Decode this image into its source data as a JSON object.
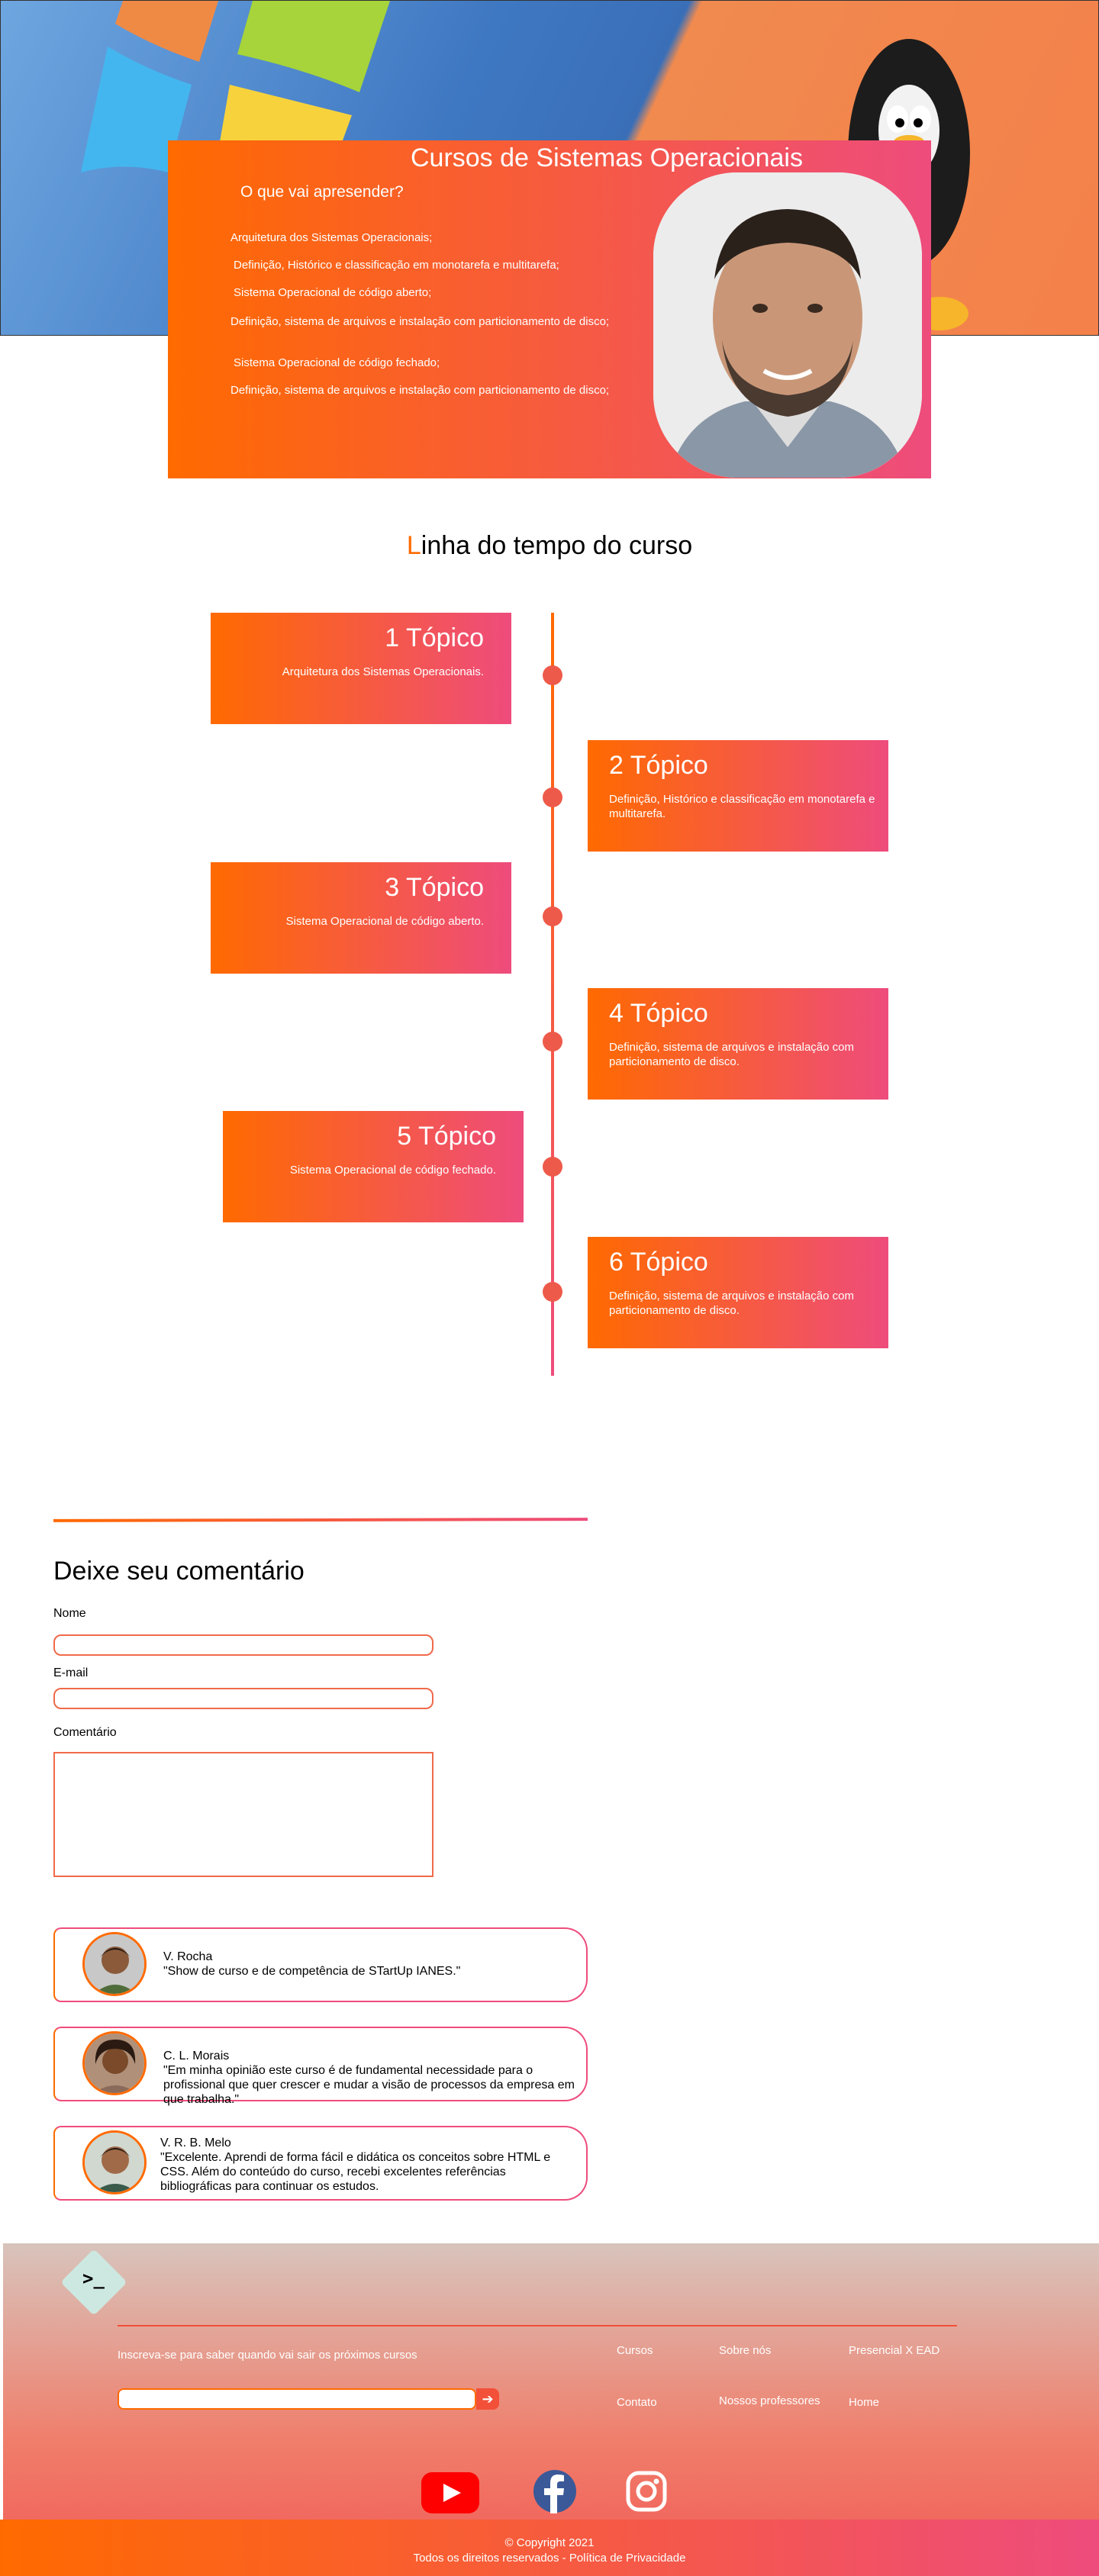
{
  "hero": {
    "title": "Cursos de Sistemas Operacionais",
    "subtitle": "O que vai apresender?",
    "items": [
      "Arquitetura dos Sistemas Operacionais;",
      "Definição, Histórico e classificação em monotarefa e multitarefa;",
      "Sistema Operacional de código aberto;",
      "Definição, sistema de arquivos e instalação com particionamento de disco;",
      "Sistema Operacional de código fechado;",
      "Definição, sistema de arquivos e instalação com particionamento de disco;"
    ]
  },
  "timeline": {
    "title_first_letter": "L",
    "title_rest": "inha do tempo do curso",
    "topics": [
      {
        "title": "1 Tópico",
        "desc": "Arquitetura dos Sistemas Operacionais."
      },
      {
        "title": "2 Tópico",
        "desc": "Definição, Histórico e classificação em monotarefa e multitarefa."
      },
      {
        "title": "3 Tópico",
        "desc": "Sistema Operacional de código aberto."
      },
      {
        "title": "4 Tópico",
        "desc": "Definição, sistema de arquivos e instalação com particionamento de disco."
      },
      {
        "title": "5 Tópico",
        "desc": "Sistema Operacional de código fechado."
      },
      {
        "title": "6 Tópico",
        "desc": "Definição, sistema de arquivos e instalação com particionamento de disco."
      }
    ]
  },
  "comment_form": {
    "title": "Deixe seu comentário",
    "name_label": "Nome",
    "email_label": "E-mail",
    "comment_label": "Comentário"
  },
  "testimonials": [
    {
      "name": "V. Rocha",
      "text": "\"Show de curso e de competência de STartUp IANES.\""
    },
    {
      "name": "C. L. Morais",
      "text": "\"Em minha opinião este curso é de fundamental necessidade para o profissional que quer crescer e mudar a visão de processos da empresa em que trabalha.\""
    },
    {
      "name": "V. R. B. Melo",
      "text": "\"Excelente. Aprendi de forma fácil e didática os conceitos sobre HTML e CSS. Além do conteúdo do curso, recebi excelentes referências bibliográficas para continuar os estudos."
    }
  ],
  "footer": {
    "logo_text": ">_",
    "newsletter_label": "Inscreva-se para saber quando vai sair os próximos cursos",
    "newsletter_button_icon": "arrow-right-icon",
    "links": [
      "Cursos",
      "Sobre nós",
      "Presencial X EAD",
      "Contato",
      "Nossos professores",
      "Home"
    ],
    "social_icons": [
      "youtube-icon",
      "facebook-icon",
      "instagram-icon"
    ],
    "copyright": "© Copyright 2021",
    "rights": "Todos os direitos reservados - Política de Privacidade"
  },
  "colors": {
    "accent_start": "#ff6a00",
    "accent_end": "#ee4c7c"
  }
}
